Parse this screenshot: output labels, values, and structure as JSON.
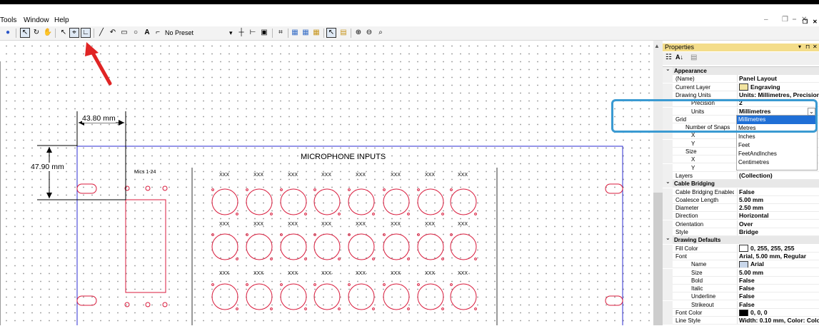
{
  "menu": {
    "tools": "Tools",
    "window": "Window",
    "help": "Help"
  },
  "toolbar": {
    "preset": "No Preset"
  },
  "canvas": {
    "dim_width": "43.80 mm",
    "dim_height": "47.90 mm",
    "panel_title": "MICROPHONE INPUTS",
    "mic_label": "Mics 1-24",
    "xxx": "XXX"
  },
  "properties": {
    "title": "Properties",
    "rows": [
      {
        "t": "cat",
        "k": "Appearance"
      },
      {
        "k": "(Name)",
        "v": "Panel Layout"
      },
      {
        "k": "Current Layer",
        "v": "Engraving",
        "swatch": "#f2e4a0"
      },
      {
        "k": "Drawing Units",
        "v": "Units: Millimetres, Precision"
      },
      {
        "k": "Precision",
        "v": "2",
        "ind": 2
      },
      {
        "k": "Units",
        "v": "Millimetres",
        "ind": 2
      },
      {
        "k": "Grid",
        "v": ""
      },
      {
        "k": "Number of Snaps",
        "v": "",
        "ind": 1
      },
      {
        "k": "X",
        "v": "",
        "ind": 2
      },
      {
        "k": "Y",
        "v": "",
        "ind": 2
      },
      {
        "k": "Size",
        "v": "",
        "ind": 1
      },
      {
        "k": "X",
        "v": "",
        "ind": 2
      },
      {
        "k": "Y",
        "v": "",
        "ind": 2
      },
      {
        "k": "Layers",
        "v": "(Collection)"
      },
      {
        "t": "cat",
        "k": "Cable Bridging"
      },
      {
        "k": "Cable Bridging Enabled",
        "v": "False"
      },
      {
        "k": "Coalesce Length",
        "v": "5.00 mm"
      },
      {
        "k": "Diameter",
        "v": "2.50 mm"
      },
      {
        "k": "Direction",
        "v": "Horizontal"
      },
      {
        "k": "Orientation",
        "v": "Over"
      },
      {
        "k": "Style",
        "v": "Bridge"
      },
      {
        "t": "cat",
        "k": "Drawing Defaults"
      },
      {
        "k": "Fill Color",
        "v": "0, 255, 255, 255",
        "swatch": "#ffffff"
      },
      {
        "k": "Font",
        "v": "Arial, 5.00 mm, Regular"
      },
      {
        "k": "Name",
        "v": "Arial",
        "ind": 2,
        "swatch": "#c8d6ea"
      },
      {
        "k": "Size",
        "v": "5.00 mm",
        "ind": 2
      },
      {
        "k": "Bold",
        "v": "False",
        "ind": 2
      },
      {
        "k": "Italic",
        "v": "False",
        "ind": 2
      },
      {
        "k": "Underline",
        "v": "False",
        "ind": 2
      },
      {
        "k": "Strikeout",
        "v": "False",
        "ind": 2
      },
      {
        "k": "Font Color",
        "v": "0, 0, 0",
        "swatch": "#000000"
      },
      {
        "k": "Line Style",
        "v": "Width: 0.10 mm, Color: Colo"
      }
    ]
  },
  "units_dropdown": {
    "options": [
      "Millimetres",
      "Metres",
      "Inches",
      "Feet",
      "FeetAndInches",
      "Centimetres"
    ],
    "selected": "Millimetres"
  },
  "colors": {
    "accent": "#1f6fd6",
    "annotation": "#3a9ad2",
    "arrow": "#e02424",
    "panel_border": "#2b2bd0",
    "connector": "#d81b3c"
  }
}
